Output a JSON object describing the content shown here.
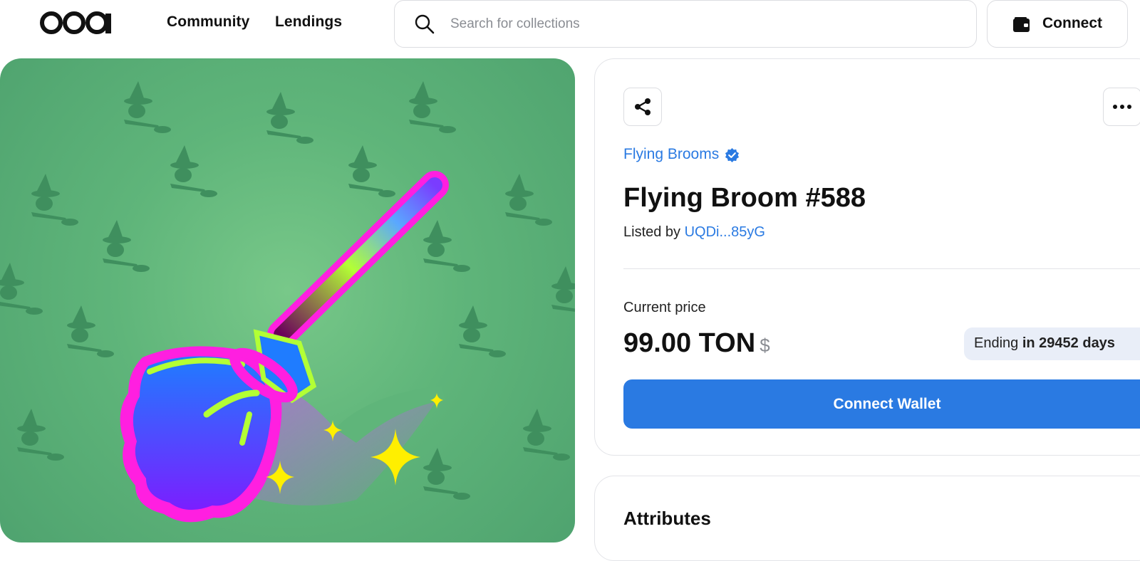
{
  "header": {
    "logo_text": "oaa",
    "nav": [
      {
        "label": "Community"
      },
      {
        "label": "Lendings"
      }
    ],
    "search": {
      "placeholder": "Search for collections",
      "value": ""
    },
    "connect_label": "Connect"
  },
  "nft": {
    "collection": "Flying Brooms",
    "title": "Flying Broom #588",
    "listed_by_prefix": "Listed by",
    "owner": "UQDi...85yG",
    "price_label": "Current price",
    "price": "99.00 TON",
    "currency_symbol": "$",
    "ending_prefix": "Ending",
    "ending_value": "in 29452 days",
    "connect_wallet_label": "Connect Wallet"
  },
  "attributes": {
    "title": "Attributes"
  },
  "colors": {
    "accent": "#2a7ae2",
    "art_background": "#5fb57a",
    "border": "#dcdde1"
  },
  "icons": [
    "search-icon",
    "wallet-icon",
    "share-icon",
    "more-icon",
    "verified-icon"
  ]
}
